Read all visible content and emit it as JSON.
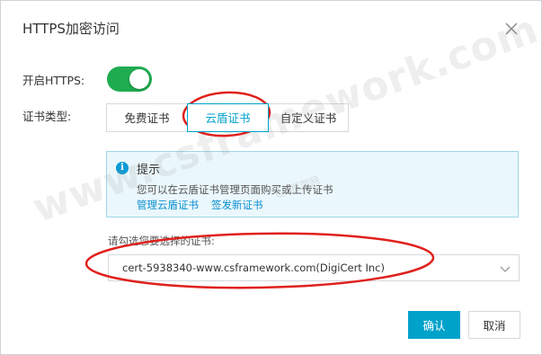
{
  "dialog": {
    "title": "HTTPS加密访问"
  },
  "https_toggle": {
    "label": "开启HTTPS:",
    "enabled": true,
    "color": "#1fab4f"
  },
  "cert_type": {
    "label": "证书类型:",
    "tabs": [
      "免费证书",
      "云盾证书",
      "自定义证书"
    ],
    "active": "云盾证书"
  },
  "tip": {
    "title": "提示",
    "icon": "info-icon",
    "text": "您可以在云盾证书管理页面购买或上传证书",
    "links": [
      "管理云盾证书",
      "签发新证书"
    ]
  },
  "cert_select": {
    "label": "请勾选您要选择的证书:",
    "value": "cert-5938340-www.csframework.com(DigiCert Inc)"
  },
  "buttons": {
    "ok": "确认",
    "cancel": "取消"
  },
  "watermark": {
    "text": "www.csframework.com",
    "sub": "C/S框架网"
  },
  "colors": {
    "accent": "#00a2ca",
    "annotation": "#e0201c",
    "link": "#0a8fd0"
  }
}
